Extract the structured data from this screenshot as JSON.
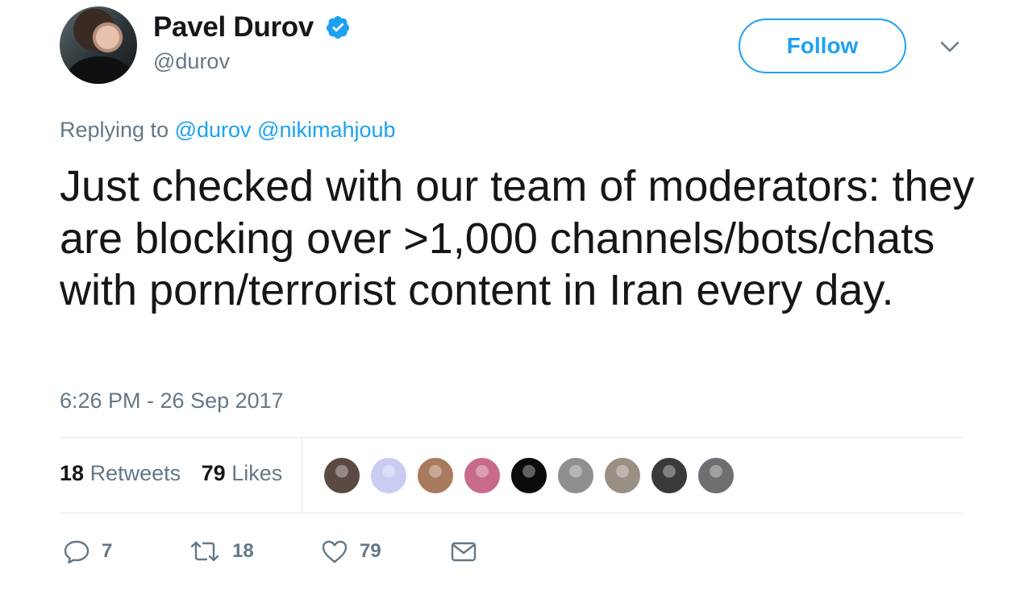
{
  "user": {
    "name": "Pavel Durov",
    "handle": "@durov",
    "verified": true
  },
  "follow_label": "Follow",
  "reply": {
    "prefix": "Replying to",
    "mentions": [
      "@durov",
      "@nikimahjoub"
    ]
  },
  "tweet_text": "Just checked with our team of moderators: they are blocking over >1,000 channels/bots/chats with porn/terrorist content in Iran every day.",
  "timestamp": "6:26 PM - 26 Sep 2017",
  "stats": {
    "retweets_count": "18",
    "retweets_label": "Retweets",
    "likes_count": "79",
    "likes_label": "Likes"
  },
  "liker_avatars": [
    {
      "name": "liker-avatar-1",
      "color": "#5a4a42"
    },
    {
      "name": "liker-avatar-2",
      "color": "#c9cdf2"
    },
    {
      "name": "liker-avatar-3",
      "color": "#a87a5e"
    },
    {
      "name": "liker-avatar-4",
      "color": "#c86a8c"
    },
    {
      "name": "liker-avatar-5",
      "color": "#0b0b0b"
    },
    {
      "name": "liker-avatar-6",
      "color": "#8f8f8f"
    },
    {
      "name": "liker-avatar-7",
      "color": "#9a8f83"
    },
    {
      "name": "liker-avatar-8",
      "color": "#3a3a3a"
    },
    {
      "name": "liker-avatar-9",
      "color": "#6e6e72"
    }
  ],
  "actions": {
    "reply_count": "7",
    "retweet_count": "18",
    "like_count": "79"
  },
  "colors": {
    "accent": "#1da1f2",
    "text": "#14171a",
    "muted": "#657786",
    "divider": "#e1e8ed"
  },
  "icons": [
    "verified-icon",
    "chevron-down-icon",
    "reply-icon",
    "retweet-icon",
    "heart-icon",
    "mail-icon"
  ]
}
